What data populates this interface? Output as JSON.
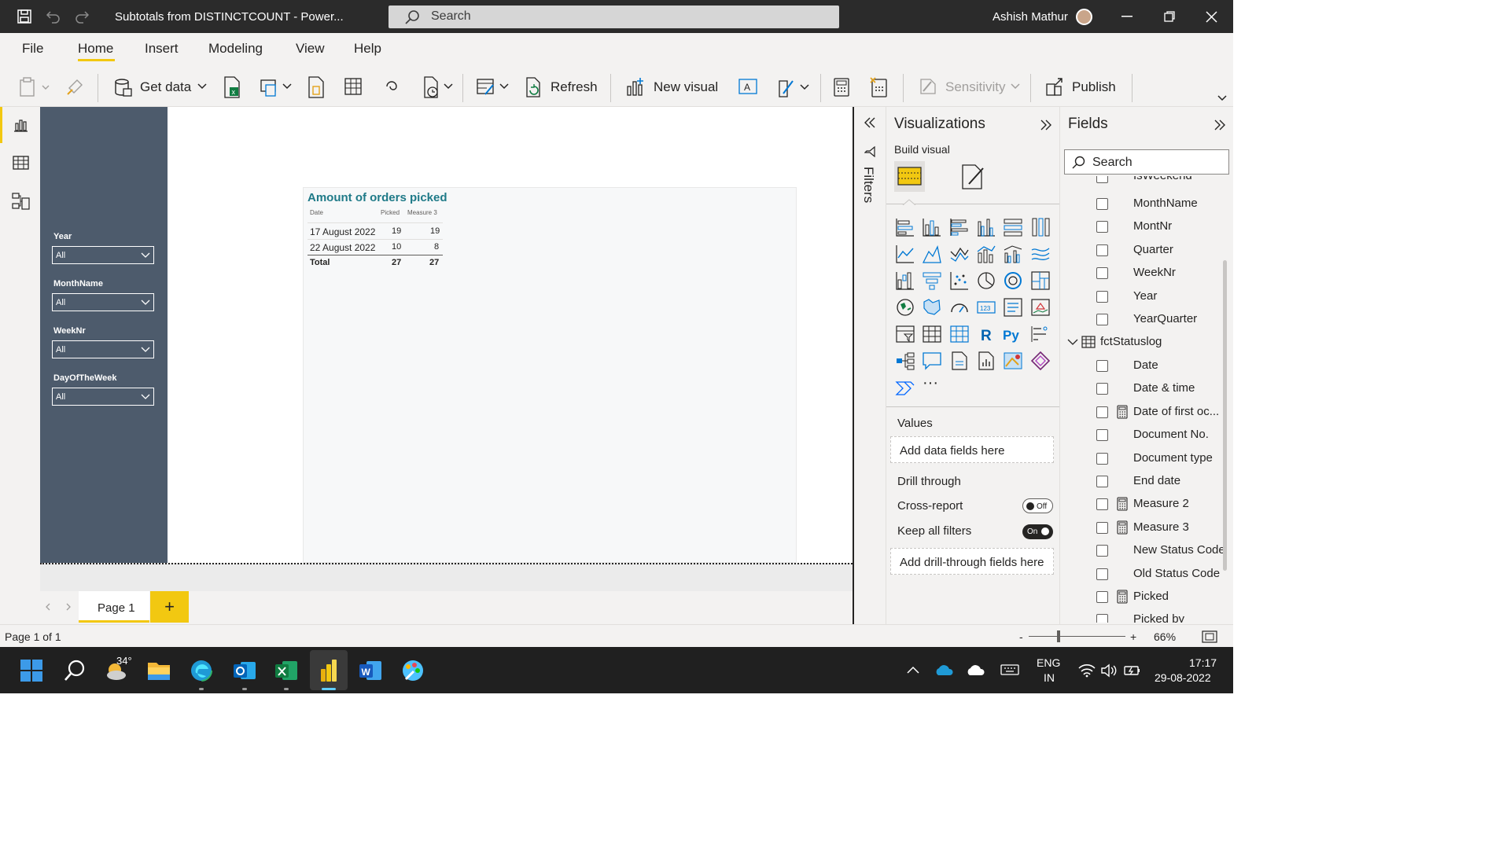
{
  "titlebar": {
    "doc_title": "Subtotals from DISTINCTCOUNT - Power...",
    "search_label": "Search",
    "user_name": "Ashish Mathur"
  },
  "menu": {
    "tabs": [
      "File",
      "Home",
      "Insert",
      "Modeling",
      "View",
      "Help"
    ],
    "active": "Home"
  },
  "ribbon": {
    "get_data": "Get data",
    "refresh": "Refresh",
    "new_visual": "New visual",
    "sensitivity": "Sensitivity",
    "publish": "Publish"
  },
  "slicers": [
    {
      "label": "Year",
      "value": "All"
    },
    {
      "label": "MonthName",
      "value": "All"
    },
    {
      "label": "WeekNr",
      "value": "All"
    },
    {
      "label": "DayOfTheWeek",
      "value": "All"
    }
  ],
  "visual": {
    "title": "Amount of orders picked",
    "headers": [
      "Date",
      "Picked",
      "Measure 3"
    ],
    "rows": [
      [
        "17 August 2022",
        "19",
        "19"
      ],
      [
        "22 August 2022",
        "10",
        "8"
      ]
    ],
    "total": [
      "Total",
      "27",
      "27"
    ]
  },
  "pages": {
    "tab_label": "Page 1",
    "add_label": "+"
  },
  "filters_label": "Filters",
  "visualizations": {
    "title": "Visualizations",
    "build_visual": "Build visual",
    "values_label": "Values",
    "values_placeholder": "Add data fields here",
    "drill_through": "Drill through",
    "cross_report": "Cross-report",
    "cross_report_state": "Off",
    "keep_filters": "Keep all filters",
    "keep_filters_state": "On",
    "drill_placeholder": "Add drill-through fields here",
    "more": "···"
  },
  "fields": {
    "title": "Fields",
    "search_placeholder": "Search",
    "partial_top": "IsWeekend",
    "items_a": [
      "MonthName",
      "MontNr",
      "Quarter",
      "WeekNr",
      "Year",
      "YearQuarter"
    ],
    "table_name": "fctStatuslog",
    "items_b": [
      {
        "name": "Date",
        "calc": false
      },
      {
        "name": "Date & time",
        "calc": false
      },
      {
        "name": "Date of first oc...",
        "calc": true
      },
      {
        "name": "Document No.",
        "calc": false
      },
      {
        "name": "Document type",
        "calc": false
      },
      {
        "name": "End date",
        "calc": false
      },
      {
        "name": "Measure 2",
        "calc": true
      },
      {
        "name": "Measure 3",
        "calc": true
      },
      {
        "name": "New Status Code",
        "calc": false
      },
      {
        "name": "Old Status Code",
        "calc": false
      },
      {
        "name": "Picked",
        "calc": true
      }
    ],
    "partial_bottom": "Picked by"
  },
  "status": {
    "page_info": "Page 1 of 1",
    "zoom": "66%",
    "zoom_minus": "-",
    "zoom_plus": "+"
  },
  "taskbar": {
    "weather": "34°",
    "lang_top": "ENG",
    "lang_bottom": "IN",
    "time": "17:17",
    "date": "29-08-2022"
  },
  "colors": {
    "accent": "#f2c811",
    "slicer_bg": "#4d5b6c",
    "title_teal": "#1f7a88",
    "titlebar": "#2b2b2b"
  }
}
